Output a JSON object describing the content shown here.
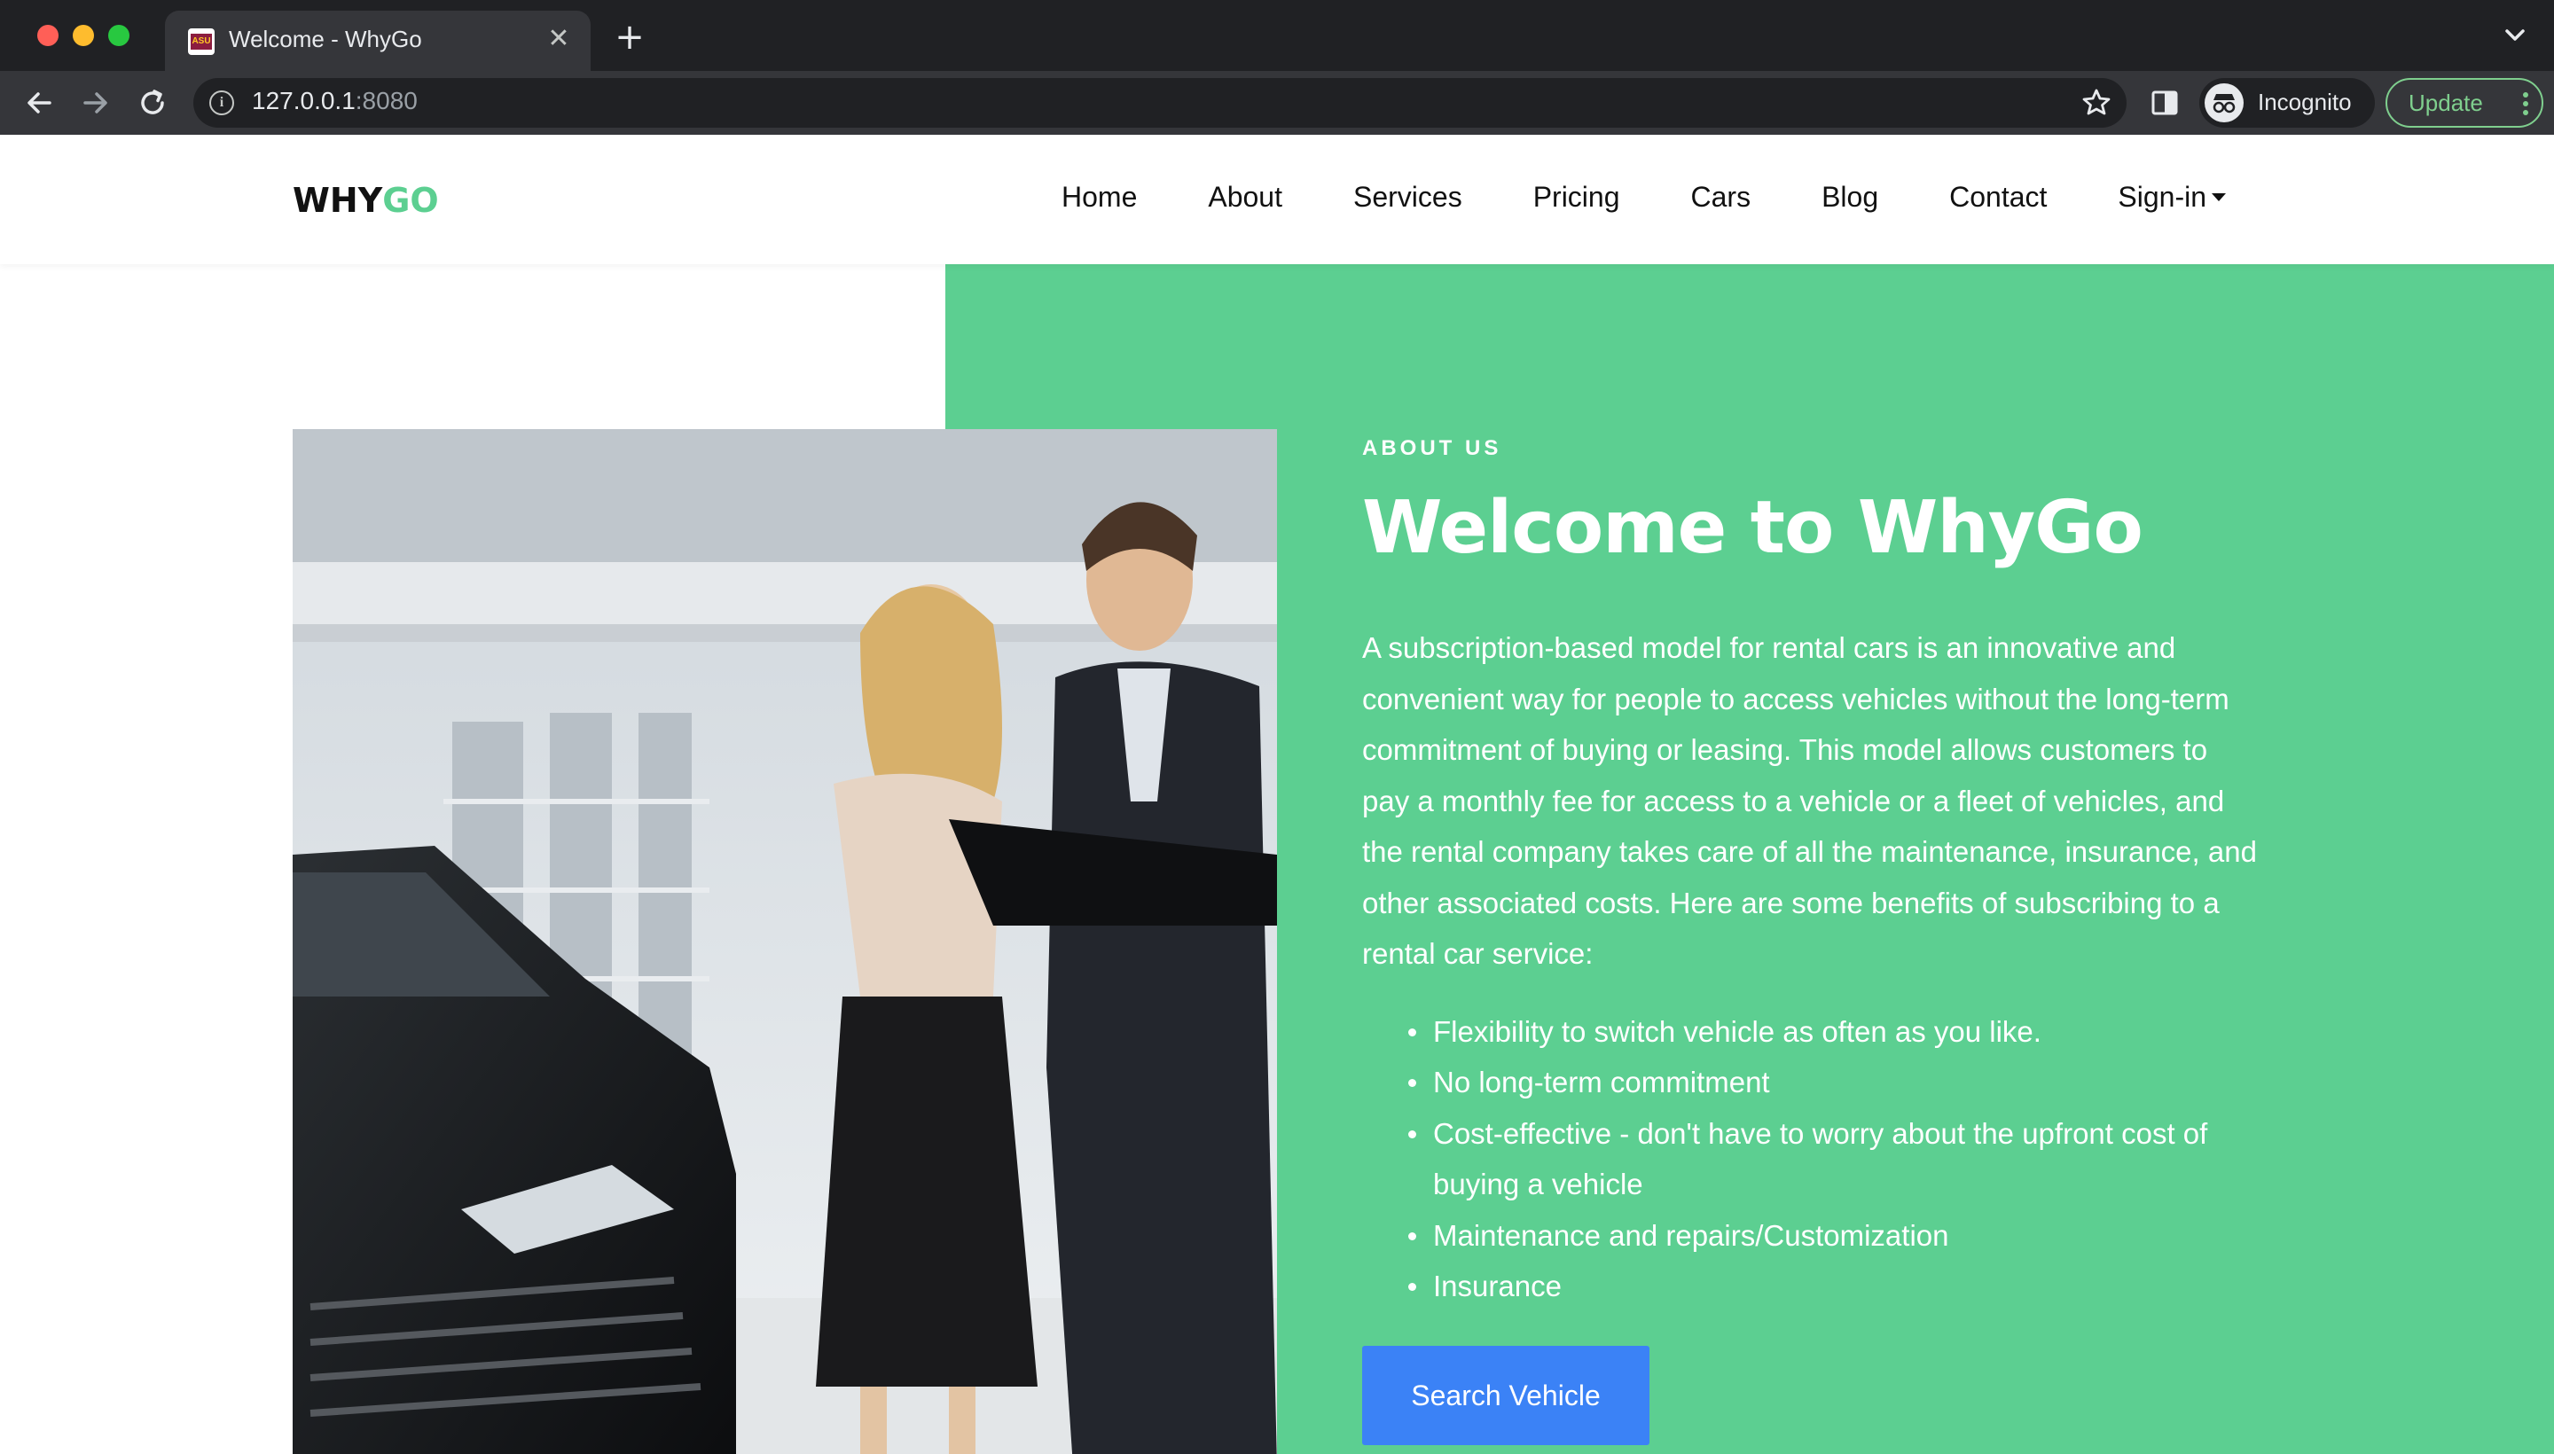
{
  "browser": {
    "tab_title": "Welcome - WhyGo",
    "favicon_text": "ASU",
    "new_tab_symbol": "+",
    "close_symbol": "✕",
    "url_host": "127.0.0.1",
    "url_port": ":8080",
    "profile_label": "Incognito",
    "update_label": "Update"
  },
  "site": {
    "logo_part1": "WHY",
    "logo_part2": "GO",
    "brand_color": "#5ccf91",
    "nav": {
      "items": [
        {
          "label": "Home"
        },
        {
          "label": "About"
        },
        {
          "label": "Services"
        },
        {
          "label": "Pricing"
        },
        {
          "label": "Cars"
        },
        {
          "label": "Blog"
        },
        {
          "label": "Contact"
        },
        {
          "label": "Sign-in"
        }
      ]
    }
  },
  "about": {
    "eyebrow": "ABOUT US",
    "title": "Welcome to WhyGo",
    "paragraph": "A subscription-based model for rental cars is an innovative and convenient way for people to access vehicles without the long-term commitment of buying or leasing. This model allows customers to pay a monthly fee for access to a vehicle or a fleet of vehicles, and the rental company takes care of all the maintenance, insurance, and other associated costs. Here are some benefits of subscribing to a rental car service:",
    "benefits": [
      "Flexibility to switch vehicle as often as you like.",
      "No long-term commitment",
      "Cost-effective - don't have to worry about the upfront cost of buying a vehicle",
      "Maintenance and repairs/Customization",
      "Insurance"
    ],
    "button_label": "Search Vehicle",
    "button_color": "#3b82f6"
  }
}
